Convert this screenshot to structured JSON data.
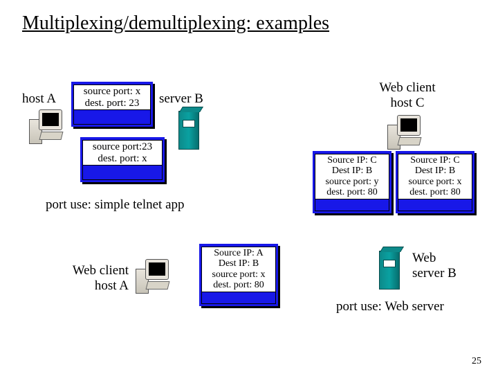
{
  "title": "Multiplexing/demultiplexing: examples",
  "labels": {
    "hostA_left": "host A",
    "serverB_top": "server B",
    "webClientC": "Web client\nhost C",
    "portUseTelnet": "port use: simple telnet app",
    "webClientA": "Web client\nhost A",
    "webServerB": "Web\nserver B",
    "portUseWeb": "port use: Web server"
  },
  "packets": {
    "p1": {
      "l1": "source port: x",
      "l2": "dest. port: 23"
    },
    "p2": {
      "l1": "source port:23",
      "l2": "dest. port: x"
    },
    "p3": {
      "l1": "Source IP: C",
      "l2": "Dest IP: B",
      "l3": "source port: y",
      "l4": "dest. port: 80"
    },
    "p4": {
      "l1": "Source IP: C",
      "l2": "Dest IP: B",
      "l3": "source port: x",
      "l4": "dest. port: 80"
    },
    "p5": {
      "l1": "Source IP: A",
      "l2": "Dest IP: B",
      "l3": "source port: x",
      "l4": "dest. port: 80"
    }
  },
  "slide_number": "25"
}
